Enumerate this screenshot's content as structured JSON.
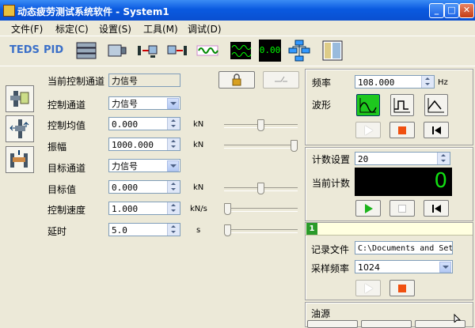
{
  "window": {
    "title": "动态疲劳测试系统软件 - System1"
  },
  "menu": [
    {
      "label": "文件(F)"
    },
    {
      "label": "标定(C)"
    },
    {
      "label": "设置(S)"
    },
    {
      "label": "工具(M)"
    },
    {
      "label": "调试(D)"
    }
  ],
  "toolbar": {
    "teds_label": "TEDS",
    "pid_label": "PID",
    "digital_label": "0.00"
  },
  "form": {
    "current_channel_label": "当前控制通道",
    "current_channel_value": "力信号",
    "control_channel_label": "控制通道",
    "control_channel_value": "力信号",
    "control_mean_label": "控制均值",
    "control_mean_value": "0.000",
    "control_mean_unit": "kN",
    "amplitude_label": "振幅",
    "amplitude_value": "1000.000",
    "amplitude_unit": "kN",
    "target_channel_label": "目标通道",
    "target_channel_value": "力信号",
    "target_value_label": "目标值",
    "target_value_value": "0.000",
    "target_value_unit": "kN",
    "control_speed_label": "控制速度",
    "control_speed_value": "1.000",
    "control_speed_unit": "kN/s",
    "delay_label": "延时",
    "delay_value": "5.0",
    "delay_unit": "s"
  },
  "sliders": {
    "control_mean": 0.5,
    "amplitude": 1.0,
    "target_value": 0.5,
    "control_speed": 0.0,
    "delay": 0.0
  },
  "freq_panel": {
    "freq_label": "频率",
    "freq_value": "108.000",
    "freq_unit": "Hz",
    "wave_label": "波形"
  },
  "count_panel": {
    "count_setting_label": "计数设置",
    "count_setting_value": "20",
    "current_count_label": "当前计数",
    "current_count_value": "0"
  },
  "record_panel": {
    "tab_label": "1",
    "record_file_label": "记录文件",
    "record_file_value": "C:\\Documents and Sett",
    "sample_rate_label": "采样频率",
    "sample_rate_value": "1024"
  },
  "oil_panel": {
    "label": "油源"
  },
  "colors": {
    "titlebar": "#0a5ae0",
    "counter_bg": "#000000",
    "counter_fg": "#12e012",
    "stop": "#f05010",
    "play": "#1bb41b"
  }
}
